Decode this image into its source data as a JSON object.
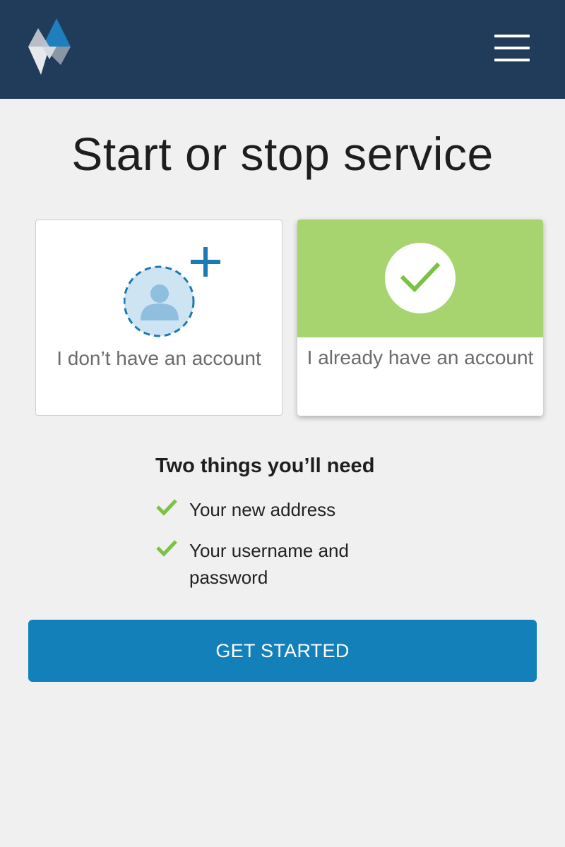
{
  "header": {
    "logo_icon": "diamond-logo-icon",
    "menu_icon": "hamburger-menu-icon"
  },
  "page": {
    "title": "Start or stop service"
  },
  "options": [
    {
      "label": "I don’t have an account",
      "icon": "add-user-icon",
      "selected": false
    },
    {
      "label": "I already have an account",
      "icon": "checkmark-circle-icon",
      "selected": true
    }
  ],
  "needs": {
    "title": "Two things you’ll need",
    "items": [
      "Your new address",
      "Your username and password"
    ]
  },
  "cta": {
    "label": "GET STARTED"
  },
  "colors": {
    "header_bg": "#213c5a",
    "accent_blue": "#1380ba",
    "selected_green": "#a8d470",
    "check_green": "#7cc242"
  }
}
